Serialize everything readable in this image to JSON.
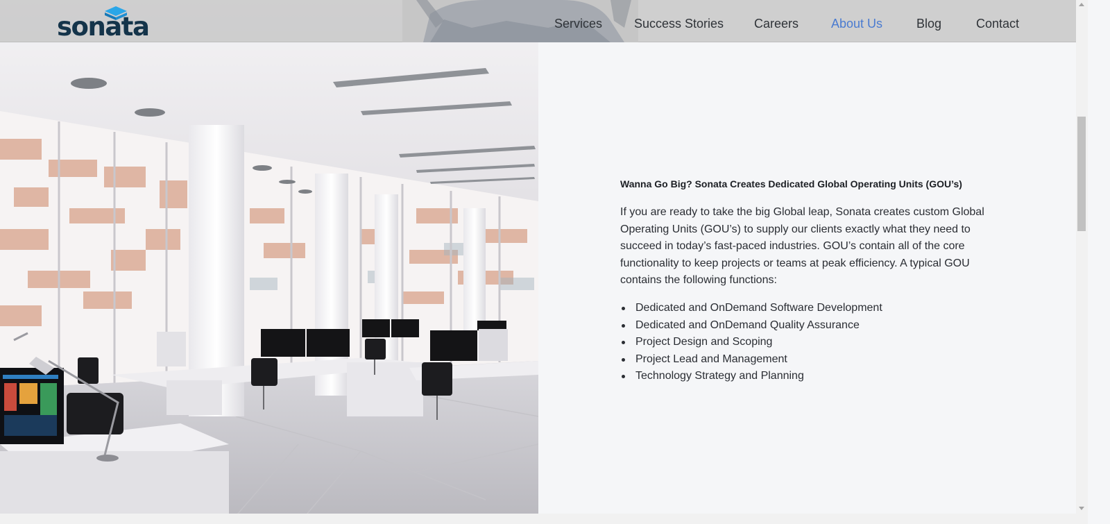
{
  "brand": {
    "name": "sonata",
    "color": "#14344a",
    "logo_accent": "#2aa6e8"
  },
  "nav": {
    "items": [
      {
        "label": "Services"
      },
      {
        "label": "Success Stories"
      },
      {
        "label": "Careers"
      },
      {
        "label": "About Us",
        "active": true
      },
      {
        "label": "Blog"
      },
      {
        "label": "Contact"
      }
    ],
    "active_color": "#4a7bd0"
  },
  "content": {
    "title": "Wanna Go Big? Sonata Creates Dedicated Global Operating Units (GOU’s)",
    "body": "If you are ready to take the big Global leap, Sonata creates custom Global Operating Units (GOU’s) to supply our clients exactly what they need to succeed in today’s fast-paced industries. GOU’s contain all of the core functionality to keep projects or teams at peak efficiency. A typical GOU contains the following functions:",
    "features": [
      "Dedicated and OnDemand Software Development",
      "Dedicated and OnDemand Quality Assurance",
      "Project Design and Scoping",
      "Project Lead and Management",
      "Technology Strategy and Planning"
    ]
  },
  "hero_image": {
    "subject": "modern-open-office-interior"
  }
}
